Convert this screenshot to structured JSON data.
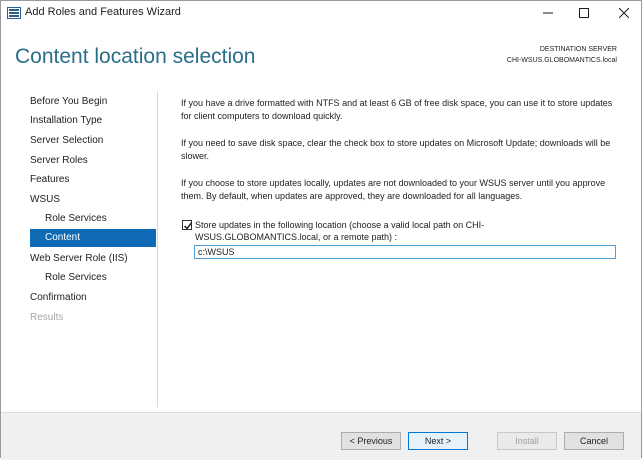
{
  "window": {
    "title": "Add Roles and Features Wizard"
  },
  "header": {
    "page_title": "Content location selection",
    "destination_label": "DESTINATION SERVER",
    "destination_server": "CHI-WSUS.GLOBOMANTICS.local"
  },
  "nav": {
    "items": [
      {
        "label": "Before You Begin",
        "state": "normal"
      },
      {
        "label": "Installation Type",
        "state": "normal"
      },
      {
        "label": "Server Selection",
        "state": "normal"
      },
      {
        "label": "Server Roles",
        "state": "normal"
      },
      {
        "label": "Features",
        "state": "normal"
      },
      {
        "label": "WSUS",
        "state": "normal"
      },
      {
        "label": "Role Services",
        "state": "normal"
      },
      {
        "label": "Content",
        "state": "selected"
      },
      {
        "label": "Web Server Role (IIS)",
        "state": "normal"
      },
      {
        "label": "Role Services",
        "state": "normal"
      },
      {
        "label": "Confirmation",
        "state": "normal"
      },
      {
        "label": "Results",
        "state": "disabled"
      }
    ],
    "selected_color": "#0f6bb5"
  },
  "content": {
    "para1": "If you have a drive formatted with NTFS and at least 6 GB of free disk space, you can use it to store updates for client computers to download quickly.",
    "para2": "If you need to save disk space, clear the check box to store updates on Microsoft Update; downloads will be slower.",
    "para3": "If you choose to store updates locally, updates are not downloaded to your WSUS server until you approve them. By default, when updates are approved, they are downloaded for all languages.",
    "checkbox_label": "Store updates in the following location (choose a valid local path on CHI-WSUS.GLOBOMANTICS.local, or a remote path) :",
    "checkbox_checked": true,
    "path_value": "c:\\WSUS"
  },
  "footer": {
    "previous_label": "< Previous",
    "next_label": "Next >",
    "install_label": "Install",
    "cancel_label": "Cancel"
  },
  "colors": {
    "title_accent": "#2a6e89",
    "input_border": "#4f9dd6"
  }
}
